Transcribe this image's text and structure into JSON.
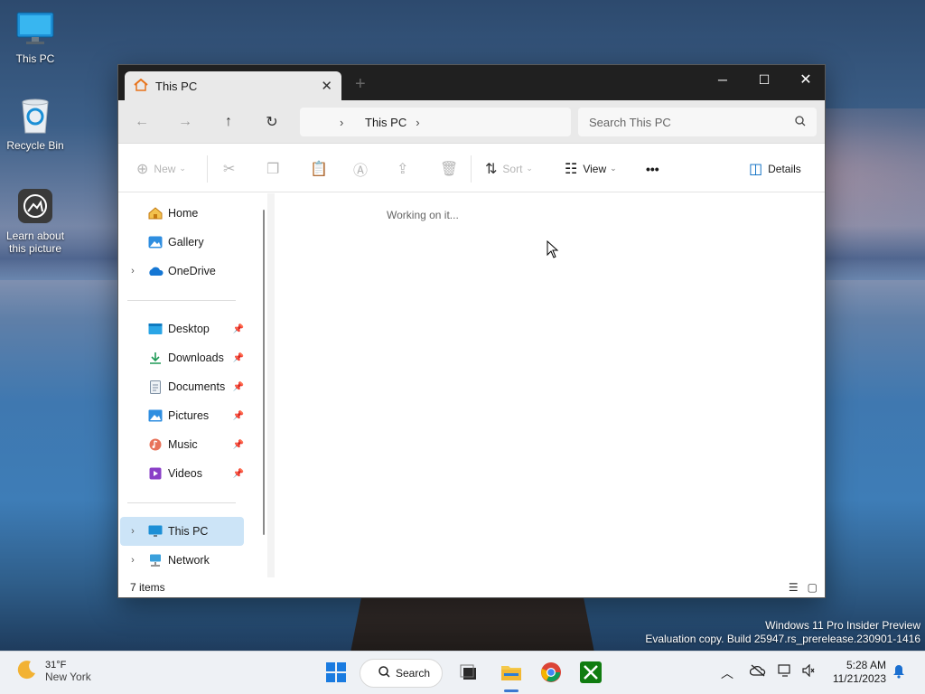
{
  "desktop": {
    "icons": [
      {
        "label": "This PC"
      },
      {
        "label": "Recycle Bin"
      },
      {
        "label": "Learn about this picture"
      }
    ],
    "watermark": {
      "line1": "Windows 11 Pro Insider Preview",
      "line2": "Evaluation copy. Build 25947.rs_prerelease.230901-1416"
    }
  },
  "explorer": {
    "tab_title": "This PC",
    "new_tab_glyph": "+",
    "address": {
      "path": "This PC"
    },
    "search": {
      "placeholder": "Search This PC"
    },
    "toolbar": {
      "new_label": "New",
      "sort_label": "Sort",
      "view_label": "View",
      "more_label": "•••",
      "details_label": "Details"
    },
    "nav": {
      "top": [
        {
          "label": "Home",
          "icon": "home-icon"
        },
        {
          "label": "Gallery",
          "icon": "gallery-icon"
        },
        {
          "label": "OneDrive",
          "icon": "onedrive-icon",
          "expandable": true
        }
      ],
      "pinned": [
        {
          "label": "Desktop",
          "icon": "desktop-folder-icon"
        },
        {
          "label": "Downloads",
          "icon": "downloads-icon"
        },
        {
          "label": "Documents",
          "icon": "documents-icon"
        },
        {
          "label": "Pictures",
          "icon": "pictures-icon"
        },
        {
          "label": "Music",
          "icon": "music-icon"
        },
        {
          "label": "Videos",
          "icon": "videos-icon"
        }
      ],
      "bottom": [
        {
          "label": "This PC",
          "icon": "this-pc-icon",
          "selected": true
        },
        {
          "label": "Network",
          "icon": "network-icon"
        }
      ]
    },
    "content_status": "Working on it...",
    "status_bar": {
      "items": "7 items"
    }
  },
  "taskbar": {
    "weather": {
      "temp": "31°F",
      "location": "New York"
    },
    "search_label": "Search",
    "clock": {
      "time": "5:28 AM",
      "date": "11/21/2023"
    }
  },
  "colors": {
    "accent": "#0067c0",
    "selected_nav": "#cce4f7",
    "titlebar": "#202020"
  }
}
